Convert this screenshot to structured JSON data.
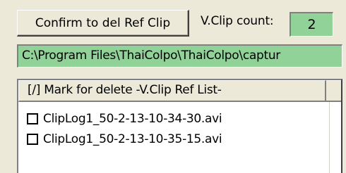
{
  "confirm_button": {
    "label": "Confirm to del Ref Clip"
  },
  "clip_count": {
    "label": "V.Clip count:",
    "value": "2"
  },
  "path_field": {
    "value": "C:\\Program Files\\ThaiColpo\\ThaiColpo\\captur"
  },
  "clip_list": {
    "header": "[/] Mark for delete -V.Clip Ref List-",
    "items": [
      {
        "label": "ClipLog1_50-2-13-10-34-30.avi",
        "checked": false
      },
      {
        "label": "ClipLog1_50-2-13-10-35-15.avi",
        "checked": false
      }
    ]
  }
}
